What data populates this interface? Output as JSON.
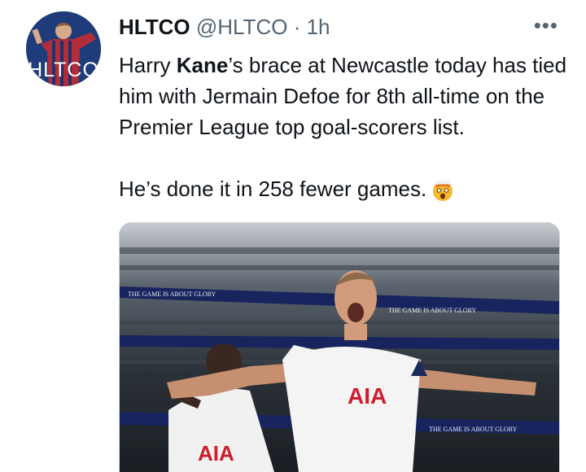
{
  "author": {
    "display_name": "HLTCO",
    "handle": "@HLTCO",
    "separator": "·",
    "time": "1h",
    "avatar_text": "HLTCO"
  },
  "tweet": {
    "line1_pre": "Harry ",
    "line1_bold": "Kane",
    "line1_post": "’s brace at Newcastle today has tied him with Jermain Defoe for 8th all-time on the Premier League top goal-scorers list.",
    "line2": "He’s done it in 258 fewer games.",
    "emoji": "exploding-head-emoji"
  },
  "menu": {
    "more_label": "•••"
  },
  "media": {
    "banner_text": "THE GAME IS ABOUT GLORY",
    "shirt_sponsor": "AIA"
  }
}
